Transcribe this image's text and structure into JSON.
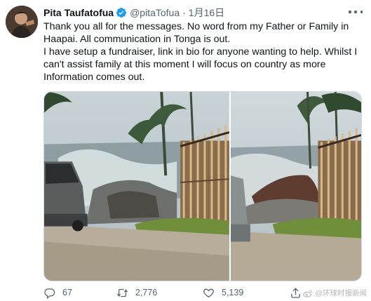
{
  "tweet": {
    "author_name": "Pita Taufatofua",
    "handle": "@pitaTofua",
    "separator": "·",
    "time": "1月16日",
    "text_lines": [
      "Thank you all for the messages. No word from my Father or Family in Haapai. All communication in Tonga is out.",
      "I have setup a fundraiser, link in bio for anyone wanting to help. Whilst I can't assist family at this moment I will focus on country as more Information comes out."
    ],
    "icons": {
      "verified": "verified-badge-icon",
      "more": "more-options-icon",
      "reply": "reply-icon",
      "retweet": "retweet-icon",
      "like": "like-icon",
      "share": "share-icon"
    },
    "metrics": {
      "replies": "67",
      "retweets": "2,776",
      "likes": "5,139"
    }
  },
  "watermark": {
    "text": "@环球时报新闻"
  },
  "colors": {
    "text": "#0f1419",
    "secondary": "#536471",
    "verified": "#1d9bf0",
    "border": "#cfd9de"
  }
}
